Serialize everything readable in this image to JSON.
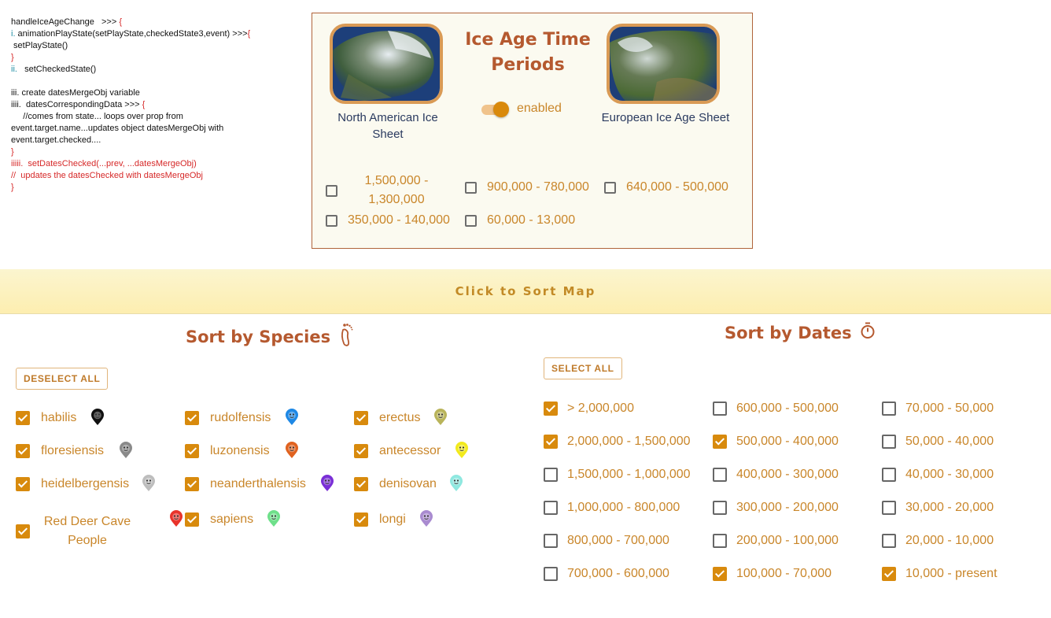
{
  "notes": {
    "lines": [
      {
        "text": "handleIceAgeChange   >>> ",
        "tail": "{",
        "tail_class": "red"
      },
      {
        "text": "i. animationPlayState(setPlayState,checkedState3,event) >>>",
        "tail": "{",
        "tail_class": "red",
        "head_class": "teal"
      },
      {
        "text": " setPlayState()"
      },
      {
        "text": "}",
        "class": "red"
      },
      {
        "text": "ii.   setCheckedState()",
        "head_class": "teal"
      },
      {
        "text": ""
      },
      {
        "text": "iii. create datesMergeObj variable"
      },
      {
        "text": "iiii.  datesCorrespondingData >>> ",
        "tail": "{",
        "tail_class": "red"
      },
      {
        "text": "     //comes from state... loops over prop from"
      },
      {
        "text": "event.target.name...updates object datesMergeObj with"
      },
      {
        "text": "event.target.checked...."
      },
      {
        "text": "}",
        "class": "red"
      },
      {
        "text": "iiiii.  setDatesChecked(...prev, ...datesMergeObj)",
        "class": "red"
      },
      {
        "text": "//  updates the datesChecked with datesMergeObj",
        "class": "red"
      },
      {
        "text": "}",
        "class": "red"
      }
    ]
  },
  "ice_panel": {
    "title": "Ice Age Time Periods",
    "toggle_label": "enabled",
    "toggle_on": true,
    "north_american": "North American Ice Sheet",
    "european": "European Ice Age Sheet",
    "periods": [
      {
        "label": "1,500,000 - 1,300,000",
        "checked": false
      },
      {
        "label": "900,000 - 780,000",
        "checked": false
      },
      {
        "label": "640,000 - 500,000",
        "checked": false
      },
      {
        "label": "350,000 - 140,000",
        "checked": false
      },
      {
        "label": "60,000 - 13,000",
        "checked": false
      }
    ]
  },
  "sort_bar": {
    "label": "Click to Sort Map"
  },
  "species_section": {
    "title": "Sort by Species",
    "icon": "footprint-icon",
    "button": "DESELECT ALL",
    "items": [
      {
        "label": "habilis",
        "checked": true,
        "icon_color": "#111111"
      },
      {
        "label": "rudolfensis",
        "checked": true,
        "icon_color": "#1e88e5"
      },
      {
        "label": "erectus",
        "checked": true,
        "icon_color": "#b9b45a"
      },
      {
        "label": "floresiensis",
        "checked": true,
        "icon_color": "#8a8a8a"
      },
      {
        "label": "luzonensis",
        "checked": true,
        "icon_color": "#e0621f"
      },
      {
        "label": "antecessor",
        "checked": true,
        "icon_color": "#f2ea1c"
      },
      {
        "label": "heidelbergensis",
        "checked": true,
        "icon_color": "#bdbdbd"
      },
      {
        "label": "neanderthalensis",
        "checked": true,
        "icon_color": "#7a2fd6"
      },
      {
        "label": "denisovan",
        "checked": true,
        "icon_color": "#8fe8e0"
      },
      {
        "label": "Red Deer Cave People",
        "checked": true,
        "icon_color": "#e8332b"
      },
      {
        "label": "sapiens",
        "checked": true,
        "icon_color": "#6ee08a"
      },
      {
        "label": "longi",
        "checked": true,
        "icon_color": "#a98bd0"
      }
    ]
  },
  "dates_section": {
    "title": "Sort by Dates",
    "icon": "stopwatch-icon",
    "button": "SELECT ALL",
    "items": [
      {
        "label": "> 2,000,000",
        "checked": true
      },
      {
        "label": "600,000 - 500,000",
        "checked": false
      },
      {
        "label": "70,000 - 50,000",
        "checked": false
      },
      {
        "label": "2,000,000 - 1,500,000",
        "checked": true
      },
      {
        "label": "500,000 - 400,000",
        "checked": true
      },
      {
        "label": "50,000 - 40,000",
        "checked": false
      },
      {
        "label": "1,500,000 - 1,000,000",
        "checked": false
      },
      {
        "label": "400,000 - 300,000",
        "checked": false
      },
      {
        "label": "40,000 - 30,000",
        "checked": false
      },
      {
        "label": "1,000,000 - 800,000",
        "checked": false
      },
      {
        "label": "300,000 - 200,000",
        "checked": false
      },
      {
        "label": "30,000 - 20,000",
        "checked": false
      },
      {
        "label": "800,000 - 700,000",
        "checked": false
      },
      {
        "label": "200,000 - 100,000",
        "checked": false
      },
      {
        "label": "20,000 - 10,000",
        "checked": false
      },
      {
        "label": "700,000 - 600,000",
        "checked": false
      },
      {
        "label": "100,000 - 70,000",
        "checked": true
      },
      {
        "label": "10,000 - present",
        "checked": true
      }
    ]
  }
}
